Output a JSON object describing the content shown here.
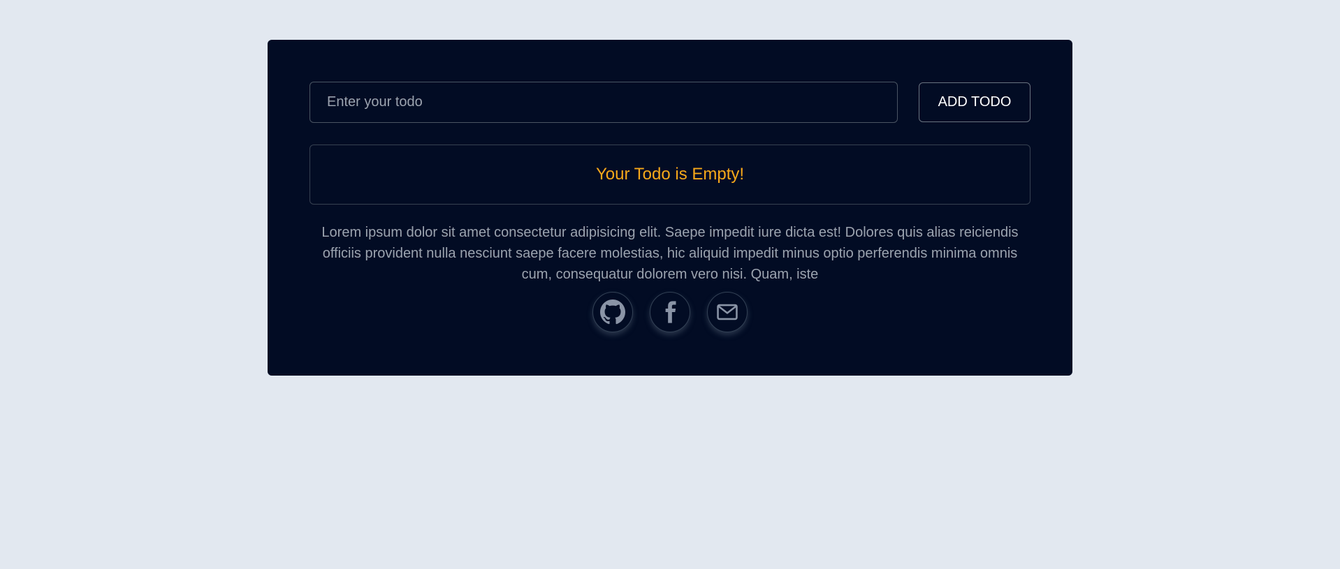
{
  "todo": {
    "input_placeholder": "Enter your todo",
    "input_value": "",
    "add_button_label": "ADD TODO",
    "empty_message": "Your Todo is Empty!"
  },
  "footer": {
    "description": "Lorem ipsum dolor sit amet consectetur adipisicing elit. Saepe impedit iure dicta est! Dolores quis alias reiciendis officiis provident nulla nesciunt saepe facere molestias, hic aliquid impedit minus optio perferendis minima omnis cum, consequatur dolorem vero nisi. Quam, iste",
    "social_icons": [
      "github-icon",
      "facebook-icon",
      "mail-icon"
    ]
  },
  "colors": {
    "page_background": "#e2e8f0",
    "card_background": "#020c24",
    "empty_message": "#f6a81a",
    "muted_text": "#9ca3af"
  }
}
